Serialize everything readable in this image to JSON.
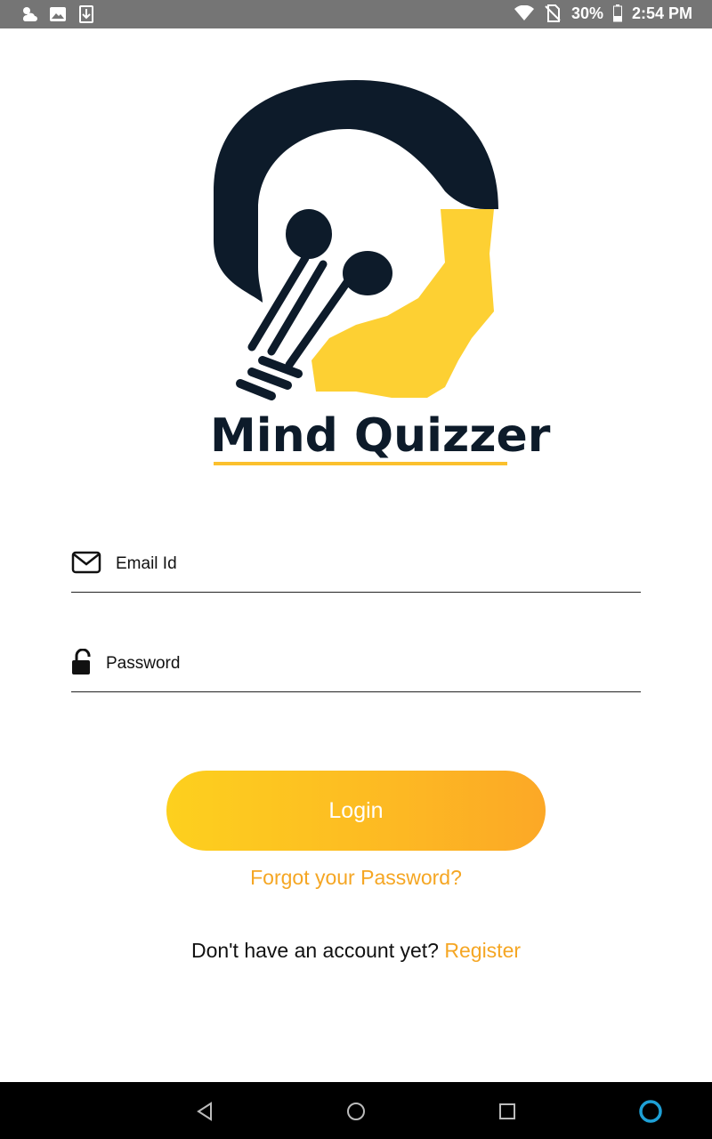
{
  "status_bar": {
    "battery": "30%",
    "time": "2:54 PM",
    "icons_left": [
      "weather-icon",
      "image-notification-icon",
      "download-notification-icon"
    ],
    "icons_right": [
      "wifi-icon",
      "no-sim-icon",
      "battery-icon"
    ]
  },
  "brand": {
    "name": "Mind Quizzer",
    "accent_color": "#fbc02d",
    "dark_color": "#0d1b2a"
  },
  "form": {
    "email_label": "Email Id",
    "password_label": "Password",
    "login_label": "Login",
    "forgot_label": "Forgot your Password?",
    "register_prompt": "Don't have an account yet?",
    "register_label": "Register",
    "link_color": "#f5a623"
  },
  "nav_bar": {
    "buttons": [
      "back-icon",
      "home-icon",
      "recents-icon",
      "assistant-icon"
    ]
  }
}
